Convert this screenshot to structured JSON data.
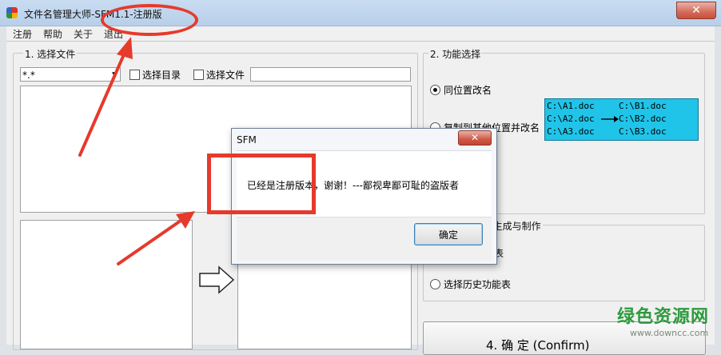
{
  "window": {
    "title": "文件名管理大师-SFM1.1-注册版",
    "close_glyph": "✕"
  },
  "menu": [
    {
      "label": "注册"
    },
    {
      "label": "帮助"
    },
    {
      "label": "关于"
    },
    {
      "label": "退出"
    }
  ],
  "section1": {
    "legend": "1. 选择文件",
    "filter_value": "*.*",
    "select_dir_label": "选择目录",
    "select_file_label": "选择文件",
    "select_file_path": ""
  },
  "section2": {
    "legend": "2. 功能选择",
    "option_same_location": "同位置改名",
    "option_copy_elsewhere": "复制到其他位置并改名",
    "selected": "同位置改名",
    "example": {
      "left": [
        "C:\\A1.doc",
        "C:\\A2.doc",
        "C:\\A3.doc"
      ],
      "right": [
        "C:\\B1.doc",
        "C:\\B2.doc",
        "C:\\B3.doc"
      ]
    }
  },
  "section3": {
    "legend_visible": ")生成与制作",
    "option_partial": "表",
    "option_history": "选择历史功能表"
  },
  "confirm_button_partial": "4. 确    定 (Confirm)",
  "dialog": {
    "title": "SFM",
    "close_glyph": "✕",
    "message": "已经是注册版本，谢谢！---鄙视卑鄙可耻的盗版者",
    "ok_label": "确定"
  },
  "watermark": {
    "name": "绿色资源网",
    "url": "www.downcc.com"
  },
  "colors": {
    "annotation_red": "#e53a2c",
    "example_bg": "#20c4e8",
    "watermark_green": "#2e9a3e"
  }
}
